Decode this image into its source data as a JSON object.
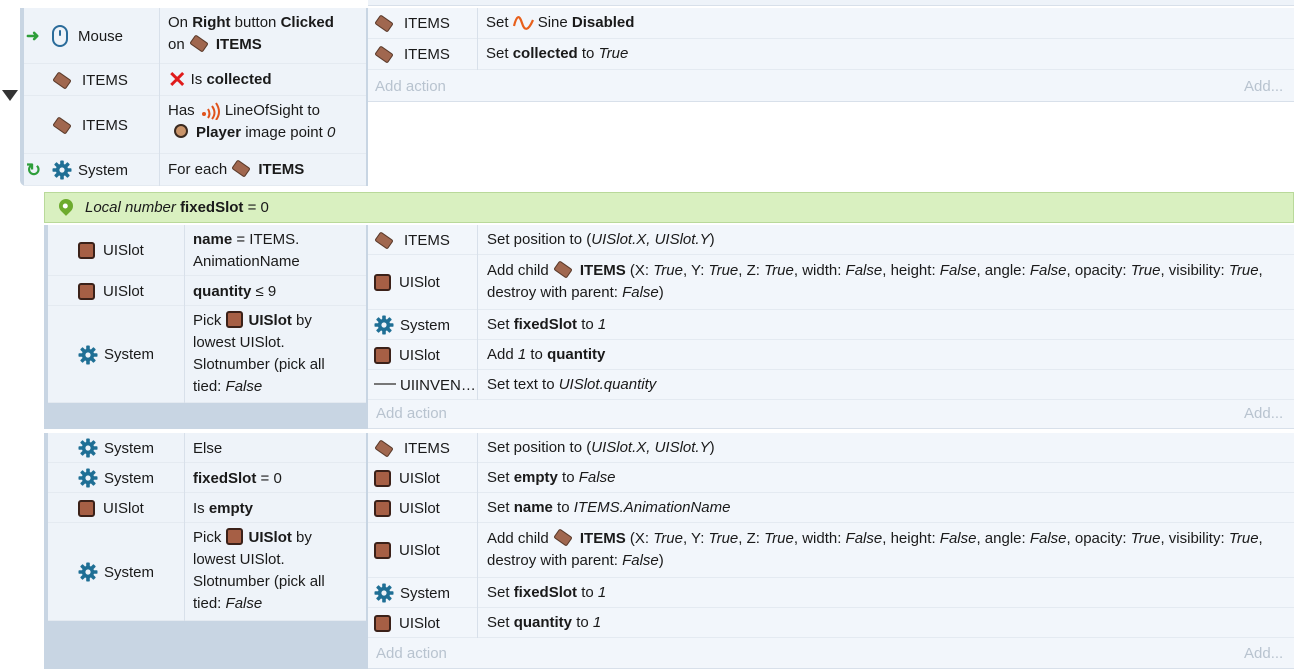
{
  "event1": {
    "conditions": [
      {
        "object": "Mouse",
        "parts": [
          [
            "On ",
            ""
          ],
          [
            "Right",
            "b"
          ],
          [
            " button ",
            ""
          ],
          [
            "Clicked",
            "b"
          ]
        ],
        "line2": [
          [
            "on ",
            ""
          ],
          [
            "@item",
            ""
          ],
          [
            "ITEMS",
            "b"
          ]
        ]
      },
      {
        "object": "ITEMS",
        "parts": [
          [
            "Is ",
            ""
          ],
          [
            "collected",
            "b"
          ]
        ]
      },
      {
        "object": "ITEMS",
        "parts": [
          [
            "Has ",
            ""
          ],
          [
            "@sight",
            ""
          ],
          [
            "LineOfSight to",
            ""
          ]
        ],
        "line2": [
          [
            "@ninja",
            ""
          ],
          [
            "Player",
            "b"
          ],
          [
            " image point ",
            ""
          ],
          [
            "0",
            "i"
          ]
        ]
      },
      {
        "object": "System",
        "parts": [
          [
            "For each ",
            ""
          ],
          [
            "@item",
            ""
          ],
          [
            "ITEMS",
            "b"
          ]
        ]
      }
    ],
    "actions": [
      {
        "object": "ITEMS",
        "parts": [
          [
            "Set ",
            ""
          ],
          [
            "@sine",
            ""
          ],
          [
            "Sine ",
            ""
          ],
          [
            "Disabled",
            "b"
          ]
        ]
      },
      {
        "object": "ITEMS",
        "parts": [
          [
            "Set ",
            ""
          ],
          [
            "collected",
            "b"
          ],
          [
            " to ",
            ""
          ],
          [
            "True",
            "i"
          ]
        ]
      }
    ],
    "add_action": "Add action",
    "add": "Add..."
  },
  "local_var": [
    [
      "Local number ",
      "i"
    ],
    [
      "fixedSlot",
      "b"
    ],
    [
      " = 0",
      ""
    ]
  ],
  "event2": {
    "conditions": [
      {
        "object": "UISlot",
        "l1": [
          [
            "name",
            "b"
          ],
          [
            " = ITEMS.",
            ""
          ]
        ],
        "l2": [
          [
            "AnimationName",
            ""
          ]
        ]
      },
      {
        "object": "UISlot",
        "l1": [
          [
            "quantity",
            "b"
          ],
          [
            " ≤ 9",
            ""
          ]
        ]
      },
      {
        "object": "System",
        "l1": [
          [
            "Pick ",
            ""
          ],
          [
            "@slot",
            ""
          ],
          [
            "UISlot",
            "b"
          ],
          [
            " by",
            ""
          ]
        ],
        "l2": [
          [
            "lowest UISlot.",
            ""
          ]
        ],
        "l3": [
          [
            "Slotnumber (pick all",
            ""
          ]
        ],
        "l4": [
          [
            "tied: ",
            ""
          ],
          [
            "False",
            "i"
          ]
        ]
      }
    ],
    "actions": [
      {
        "object": "ITEMS",
        "l1": [
          [
            "Set position to (",
            ""
          ],
          [
            "UISlot.X, UISlot.Y",
            "i"
          ],
          [
            ")",
            ""
          ]
        ]
      },
      {
        "object": "UISlot",
        "l1": [
          [
            "Add child ",
            ""
          ],
          [
            "@item",
            ""
          ],
          [
            "ITEMS",
            "b"
          ],
          [
            " (X: ",
            ""
          ],
          [
            "True",
            "i"
          ],
          [
            ", Y: ",
            ""
          ],
          [
            "True",
            "i"
          ],
          [
            ", Z: ",
            ""
          ],
          [
            "True",
            "i"
          ],
          [
            ", width: ",
            ""
          ],
          [
            "False",
            "i"
          ],
          [
            ", height: ",
            ""
          ],
          [
            "False",
            "i"
          ],
          [
            ", angle: ",
            ""
          ],
          [
            "False",
            "i"
          ],
          [
            ", opacity: ",
            ""
          ],
          [
            "True",
            "i"
          ],
          [
            ", visibility: ",
            ""
          ],
          [
            "True",
            "i"
          ],
          [
            ",",
            ""
          ]
        ],
        "l2": [
          [
            "destroy with parent: ",
            ""
          ],
          [
            "False",
            "i"
          ],
          [
            ")",
            ""
          ]
        ]
      },
      {
        "object": "System",
        "l1": [
          [
            "Set ",
            ""
          ],
          [
            "fixedSlot",
            "b"
          ],
          [
            " to ",
            ""
          ],
          [
            "1",
            "i"
          ]
        ]
      },
      {
        "object": "UISlot",
        "l1": [
          [
            "Add ",
            ""
          ],
          [
            "1",
            "i"
          ],
          [
            " to ",
            ""
          ],
          [
            "quantity",
            "b"
          ]
        ]
      },
      {
        "object": "UIINVEN…",
        "l1": [
          [
            "Set text to ",
            ""
          ],
          [
            "UISlot.quantity",
            "i"
          ]
        ]
      }
    ],
    "add_action": "Add action",
    "add": "Add..."
  },
  "event3": {
    "conditions": [
      {
        "object": "System",
        "l1": [
          [
            "Else",
            ""
          ]
        ]
      },
      {
        "object": "System",
        "l1": [
          [
            "fixedSlot",
            "b"
          ],
          [
            " = 0",
            ""
          ]
        ]
      },
      {
        "object": "UISlot",
        "l1": [
          [
            "Is ",
            ""
          ],
          [
            "empty",
            "b"
          ]
        ]
      },
      {
        "object": "System",
        "l1": [
          [
            "Pick ",
            ""
          ],
          [
            "@slot",
            ""
          ],
          [
            "UISlot",
            "b"
          ],
          [
            " by",
            ""
          ]
        ],
        "l2": [
          [
            "lowest UISlot.",
            ""
          ]
        ],
        "l3": [
          [
            "Slotnumber (pick all",
            ""
          ]
        ],
        "l4": [
          [
            "tied: ",
            ""
          ],
          [
            "False",
            "i"
          ]
        ]
      }
    ],
    "actions": [
      {
        "object": "ITEMS",
        "l1": [
          [
            "Set position to (",
            ""
          ],
          [
            "UISlot.X, UISlot.Y",
            "i"
          ],
          [
            ")",
            ""
          ]
        ]
      },
      {
        "object": "UISlot",
        "l1": [
          [
            "Set ",
            ""
          ],
          [
            "empty",
            "b"
          ],
          [
            " to ",
            ""
          ],
          [
            "False",
            "i"
          ]
        ]
      },
      {
        "object": "UISlot",
        "l1": [
          [
            "Set ",
            ""
          ],
          [
            "name",
            "b"
          ],
          [
            " to ",
            ""
          ],
          [
            "ITEMS.AnimationName",
            "i"
          ]
        ]
      },
      {
        "object": "UISlot",
        "l1": [
          [
            "Add child ",
            ""
          ],
          [
            "@item",
            ""
          ],
          [
            "ITEMS",
            "b"
          ],
          [
            " (X: ",
            ""
          ],
          [
            "True",
            "i"
          ],
          [
            ", Y: ",
            ""
          ],
          [
            "True",
            "i"
          ],
          [
            ", Z: ",
            ""
          ],
          [
            "True",
            "i"
          ],
          [
            ", width: ",
            ""
          ],
          [
            "False",
            "i"
          ],
          [
            ", height: ",
            ""
          ],
          [
            "False",
            "i"
          ],
          [
            ", angle: ",
            ""
          ],
          [
            "False",
            "i"
          ],
          [
            ", opacity: ",
            ""
          ],
          [
            "True",
            "i"
          ],
          [
            ", visibility: ",
            ""
          ],
          [
            "True",
            "i"
          ],
          [
            ",",
            ""
          ]
        ],
        "l2": [
          [
            "destroy with parent: ",
            ""
          ],
          [
            "False",
            "i"
          ],
          [
            ")",
            ""
          ]
        ]
      },
      {
        "object": "System",
        "l1": [
          [
            "Set ",
            ""
          ],
          [
            "fixedSlot",
            "b"
          ],
          [
            " to ",
            ""
          ],
          [
            "1",
            "i"
          ]
        ]
      },
      {
        "object": "UISlot",
        "l1": [
          [
            "Set ",
            ""
          ],
          [
            "quantity",
            "b"
          ],
          [
            " to ",
            ""
          ],
          [
            "1",
            "i"
          ]
        ]
      }
    ],
    "add_action": "Add action",
    "add": "Add..."
  },
  "icons": {
    "mouse": "mouse-icon",
    "items": "items-sprite-icon",
    "uislot": "uislot-sprite-icon",
    "system": "gear-icon",
    "text": "text-object-icon",
    "sine": "sine-behavior-icon",
    "sight": "line-of-sight-icon",
    "player": "player-sprite-icon",
    "local": "local-variable-pin-icon"
  },
  "colors": {
    "event_bar": "#c8d5e3",
    "local_bar": "#d9f0c0",
    "gear": "#1f6f95",
    "invert_x": "#e01b1b",
    "trigger_arrow": "#2e9e3a"
  }
}
